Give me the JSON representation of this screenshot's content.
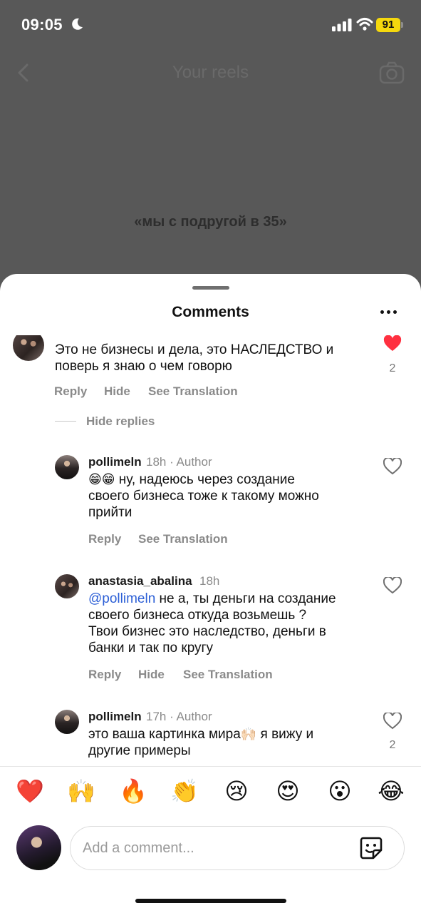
{
  "status": {
    "time": "09:05",
    "battery": "91"
  },
  "background": {
    "title": "Your reels",
    "caption": "«мы с подругой в 35»"
  },
  "sheet": {
    "title": "Comments"
  },
  "comments": [
    {
      "text": "Это не бизнесы и дела, это НАСЛЕДСТВО и\nповерь я знаю о чем говорю",
      "likes": "2",
      "actions": {
        "reply": "Reply",
        "hide": "Hide",
        "translate": "See Translation"
      },
      "hide_replies": "Hide replies"
    },
    {
      "username": "pollimeln",
      "meta": "18h · Author",
      "emoji": "😁😁",
      "text": " ну, надеюсь через создание\nсвоего бизнеса тоже к такому можно\nприйти",
      "actions": {
        "reply": "Reply",
        "translate": "See Translation"
      }
    },
    {
      "username": "anastasia_abalina",
      "meta": "18h",
      "mention": "@pollimeln",
      "text": " не а, ты деньги на создание\nсвоего бизнеса откуда возьмешь ?\nТвои бизнес это наследство, деньги в\nбанки и так по кругу",
      "actions": {
        "reply": "Reply",
        "hide": "Hide",
        "translate": "See Translation"
      }
    },
    {
      "username": "pollimeln",
      "meta": "17h · Author",
      "text_before": "это ваша картинка мира",
      "emoji": "🙌🏻",
      "text_after": " я вижу и\nдругие примеры",
      "likes": "2"
    }
  ],
  "emoji_bar": [
    "❤️",
    "🙌",
    "🔥",
    "👏",
    "😢",
    "😍",
    "😮",
    "😂"
  ],
  "composer": {
    "placeholder": "Add a comment..."
  },
  "colors": {
    "liked_heart": "#ff3040",
    "mention": "#2c5fd6",
    "battery": "#f5d80d"
  }
}
